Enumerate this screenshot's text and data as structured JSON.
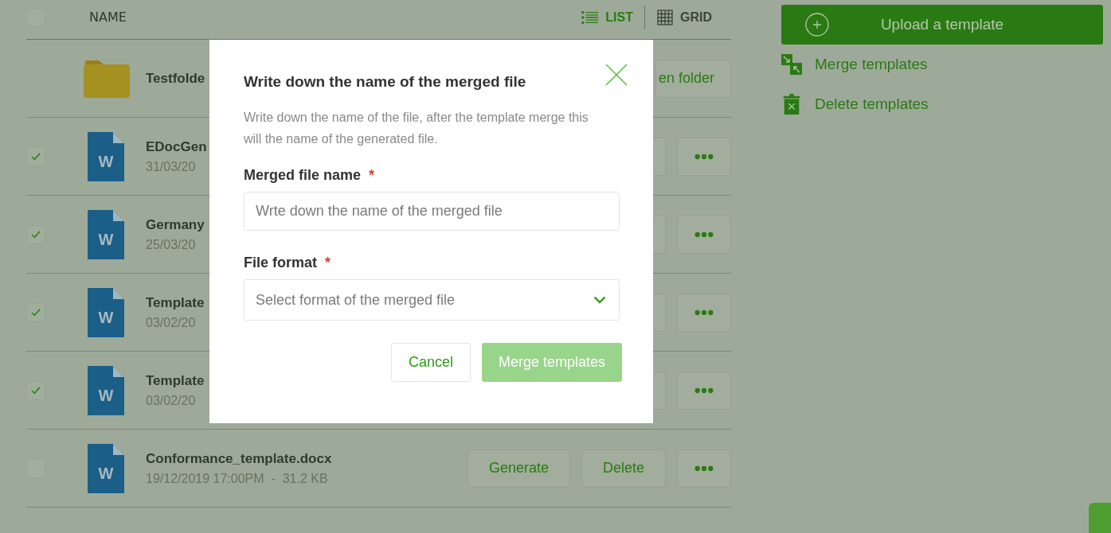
{
  "table": {
    "select_all": {
      "checked": false
    },
    "column": "NAME",
    "view_toggle": [
      {
        "label": "LIST",
        "selected": true,
        "kind": "list"
      },
      {
        "label": "GRID",
        "selected": false,
        "kind": "grid"
      }
    ],
    "rows": [
      {
        "kind": "folder",
        "name": "Testfolde",
        "actions": [
          "en folder"
        ]
      },
      {
        "kind": "docx",
        "icon_letter": "W",
        "checked": true,
        "name": "EDocGen",
        "meta": "31/03/20"
      },
      {
        "kind": "docx",
        "icon_letter": "W",
        "checked": true,
        "name": "Germany",
        "meta": "25/03/20"
      },
      {
        "kind": "docx",
        "icon_letter": "W",
        "checked": true,
        "name": "Template",
        "meta": "03/02/20"
      },
      {
        "kind": "docx",
        "icon_letter": "W",
        "checked": true,
        "name": "Template",
        "meta": "03/02/20"
      },
      {
        "kind": "docx",
        "icon_letter": "W",
        "checked": false,
        "name": "Conformance_template.docx",
        "meta": "19/12/2019 17:00PM  -  31.2 KB",
        "actions": [
          "Generate",
          "Delete"
        ]
      }
    ]
  },
  "sidebar": {
    "upload": "Upload a template",
    "actions": [
      {
        "label": "Merge templates",
        "kind": "merge"
      },
      {
        "label": "Delete templates",
        "kind": "delete"
      }
    ]
  },
  "modal": {
    "title": "Write down the name of the merged file",
    "description": "Write down the name of the file, after the template merge this will the name of the generated file.",
    "fields": [
      {
        "kind": "text",
        "label": "Merged file name",
        "required_mark": "*",
        "placeholder": "Wrte down the name of the merged file"
      },
      {
        "kind": "select",
        "label": "File format",
        "required_mark": "*",
        "placeholder": "Select format of the merged file"
      }
    ],
    "cancel": "Cancel",
    "submit": {
      "label": "Merge templates",
      "disabled": true
    }
  }
}
